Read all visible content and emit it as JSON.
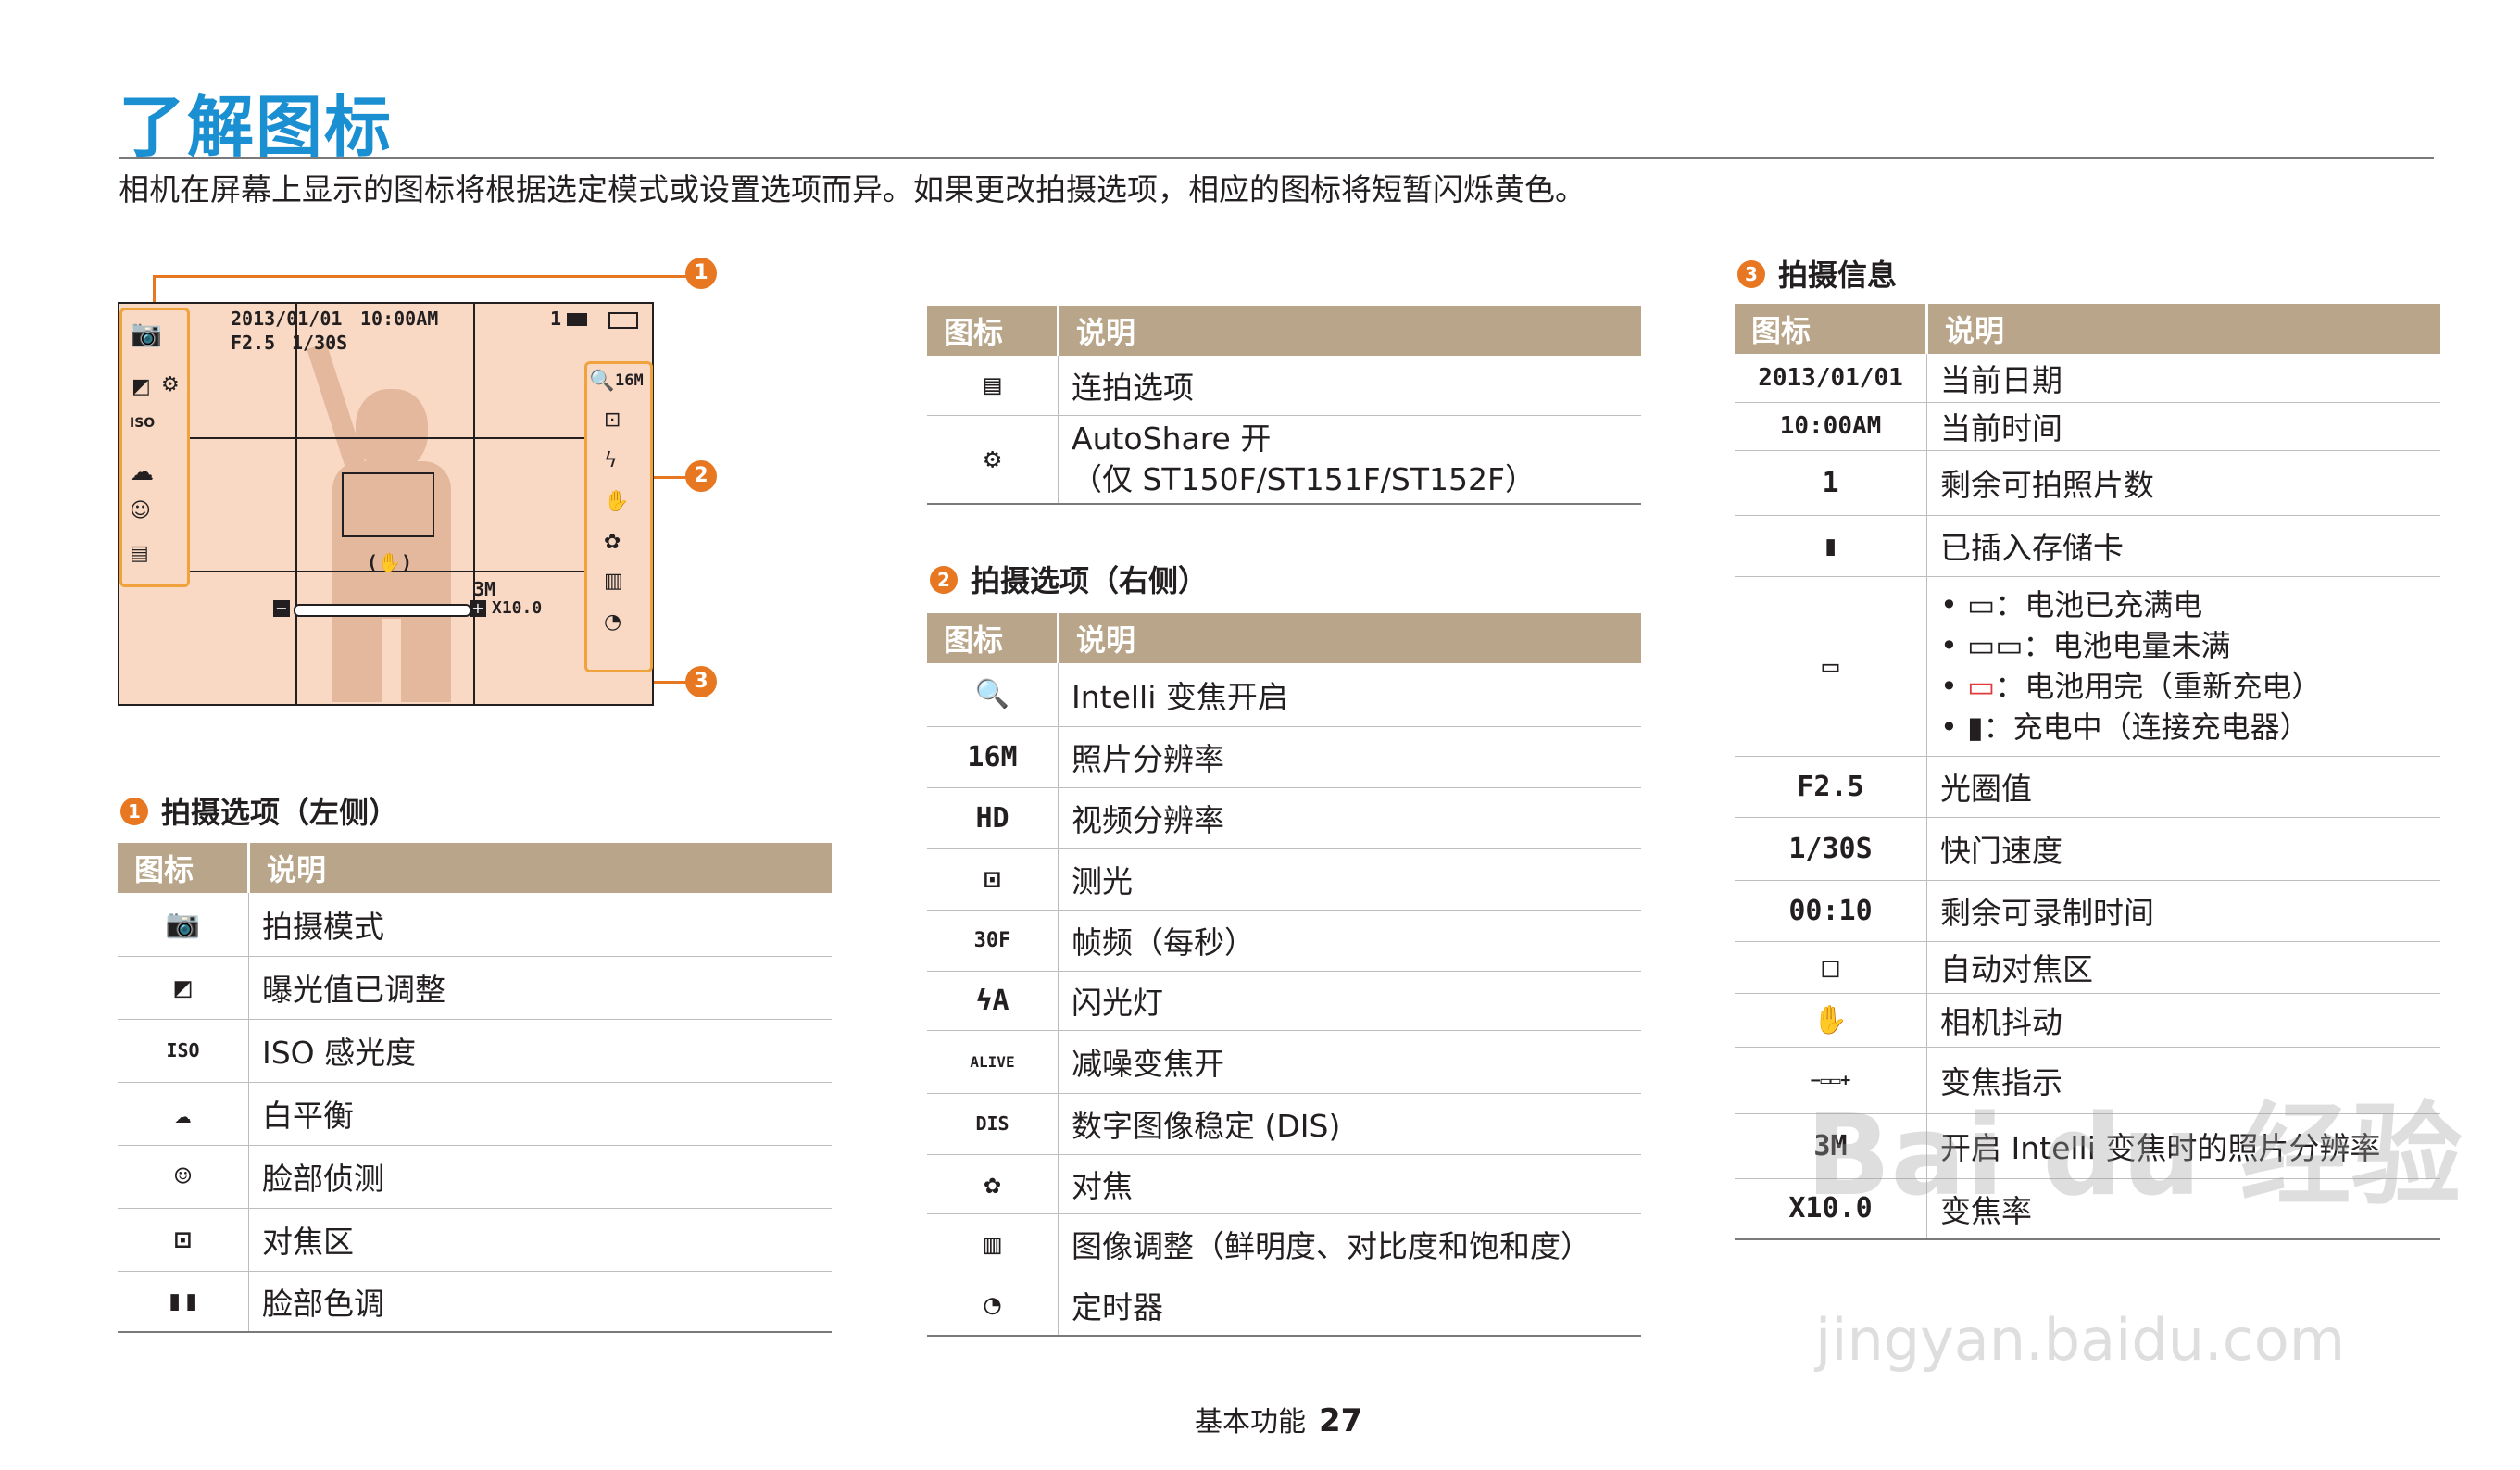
{
  "page": {
    "title": "了解图标",
    "intro": "相机在屏幕上显示的图标将根据选定模式或设置选项而异。如果更改拍摄选项，相应的图标将短暂闪烁黄色。",
    "footer_label": "基本功能",
    "page_number": "27"
  },
  "screen": {
    "date": "2013/01/01",
    "time": "10:00AM",
    "aperture": "F2.5",
    "shutter": "1/30S",
    "shots": "1",
    "resolution": "16M",
    "intelli_res": "3M",
    "zoom": "X10.0",
    "callouts": [
      "1",
      "2",
      "3"
    ]
  },
  "icons": {
    "shoot-mode": "camera-p-icon",
    "ev": "ev-icon",
    "iso": "iso-icon",
    "wb": "cloud-icon",
    "face": "face-detect-icon",
    "focus-area": "focus-area-icon",
    "face-tone": "face-tone-icon",
    "continuous": "continuous-icon",
    "autoshare": "autoshare-icon",
    "intelli-zoom": "intelli-zoom-icon",
    "metering": "metering-icon",
    "flash": "flash-icon",
    "dis": "dis-icon",
    "macro": "tulip-icon",
    "image-adjust": "image-adjust-icon",
    "timer": "timer-icon",
    "shake": "hand-shake-icon",
    "card": "memory-card-icon",
    "battery": "battery-icon"
  },
  "colors": {
    "title": "#1a8fd1",
    "accent": "#e87722",
    "header": "#b9a68a",
    "screen": "#f9d9c3"
  },
  "table_top": {
    "col_icon": "图标",
    "col_desc": "说明",
    "rows": [
      {
        "desc": "连拍选项"
      },
      {
        "desc": "AutoShare 开",
        "desc2": "（仅 ST150F/ST151F/ST152F）"
      }
    ]
  },
  "section1": {
    "number": "1",
    "title": "拍摄选项（左侧）",
    "col_icon": "图标",
    "col_desc": "说明",
    "rows": [
      {
        "desc": "拍摄模式"
      },
      {
        "desc": "曝光值已调整"
      },
      {
        "icon_text": "ISO",
        "desc": "ISO 感光度"
      },
      {
        "desc": "白平衡"
      },
      {
        "desc": "脸部侦测"
      },
      {
        "desc": "对焦区"
      },
      {
        "desc": "脸部色调"
      }
    ]
  },
  "section2": {
    "number": "2",
    "title": "拍摄选项（右侧）",
    "col_icon": "图标",
    "col_desc": "说明",
    "rows": [
      {
        "desc": "Intelli 变焦开启"
      },
      {
        "icon_text": "16M",
        "desc": "照片分辨率"
      },
      {
        "icon_text": "HD",
        "desc": "视频分辨率"
      },
      {
        "desc": "测光"
      },
      {
        "icon_text": "30F",
        "desc": "帧频（每秒）"
      },
      {
        "icon_text": "ϟA",
        "desc": "闪光灯"
      },
      {
        "icon_text": "ALIVE",
        "desc": "减噪变焦开"
      },
      {
        "icon_text": "DIS",
        "desc": "数字图像稳定 (DIS)"
      },
      {
        "desc": "对焦"
      },
      {
        "desc": "图像调整（鲜明度、对比度和饱和度）"
      },
      {
        "desc": "定时器"
      }
    ]
  },
  "section3": {
    "number": "3",
    "title": "拍摄信息",
    "col_icon": "图标",
    "col_desc": "说明",
    "rows": [
      {
        "icon_text": "2013/01/01",
        "desc": "当前日期"
      },
      {
        "icon_text": "10:00AM",
        "desc": "当前时间"
      },
      {
        "icon_text": "1",
        "desc": "剩余可拍照片数"
      },
      {
        "desc": "已插入存储卡"
      },
      {
        "desc": "battery",
        "items": [
          "：电池已充满电",
          "：电池电量未满",
          "：电池用完（重新充电）",
          "：充电中（连接充电器）"
        ]
      },
      {
        "icon_text": "F2.5",
        "desc": "光圈值"
      },
      {
        "icon_text": "1/30S",
        "desc": "快门速度"
      },
      {
        "icon_text": "00:10",
        "desc": "剩余可录制时间"
      },
      {
        "desc": "自动对焦区"
      },
      {
        "desc": "相机抖动"
      },
      {
        "desc": "变焦指示"
      },
      {
        "icon_text": "3M",
        "desc": "开启 Intelli 变焦时的照片分辨率"
      },
      {
        "icon_text": "X10.0",
        "desc": "变焦率"
      }
    ]
  },
  "watermark": {
    "main": "Bai du 经验",
    "url": "jingyan.baidu.com"
  }
}
